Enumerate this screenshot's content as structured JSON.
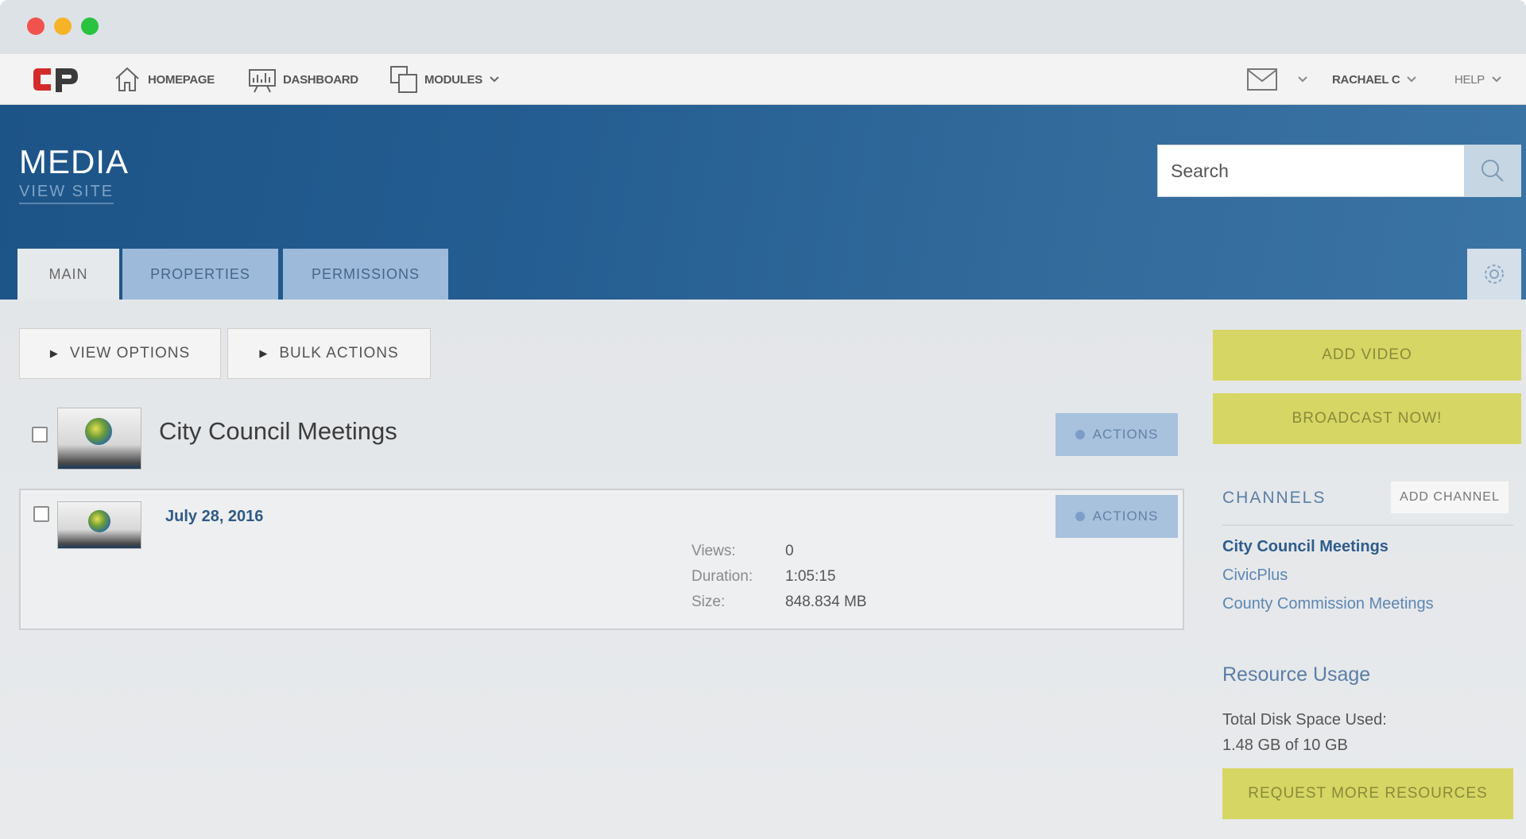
{
  "nav": {
    "homepage": "HOMEPAGE",
    "dashboard": "DASHBOARD",
    "modules": "MODULES",
    "user": "RACHAEL C",
    "help": "HELP"
  },
  "header": {
    "title": "MEDIA",
    "view_site": "VIEW SITE",
    "search_placeholder": "Search"
  },
  "tabs": [
    {
      "label": "MAIN",
      "active": true
    },
    {
      "label": "PROPERTIES",
      "active": false
    },
    {
      "label": "PERMISSIONS",
      "active": false
    }
  ],
  "toolbar": {
    "view_options": "VIEW OPTIONS",
    "bulk_actions": "BULK ACTIONS"
  },
  "folder": {
    "title": "City Council Meetings",
    "actions": "ACTIONS"
  },
  "video": {
    "date": "July 28, 2016",
    "actions": "ACTIONS",
    "stats": [
      {
        "label": "Views:",
        "value": "0"
      },
      {
        "label": "Duration:",
        "value": "1:05:15"
      },
      {
        "label": "Size:",
        "value": "848.834 MB"
      }
    ]
  },
  "sidebar": {
    "add_video": "ADD VIDEO",
    "broadcast": "BROADCAST NOW!",
    "channels_title": "CHANNELS",
    "add_channel": "ADD CHANNEL",
    "channels": [
      "City Council Meetings",
      "CivicPlus",
      "County Commission Meetings"
    ],
    "resource_title": "Resource Usage",
    "disk_label": "Total Disk Space Used:",
    "disk_value": "1.48 GB of 10 GB",
    "request_more": "REQUEST MORE RESOURCES"
  },
  "colors": {
    "header_blue": "#1d5488",
    "accent_yellow": "#d6d664",
    "logo_red": "#d42a2a"
  }
}
